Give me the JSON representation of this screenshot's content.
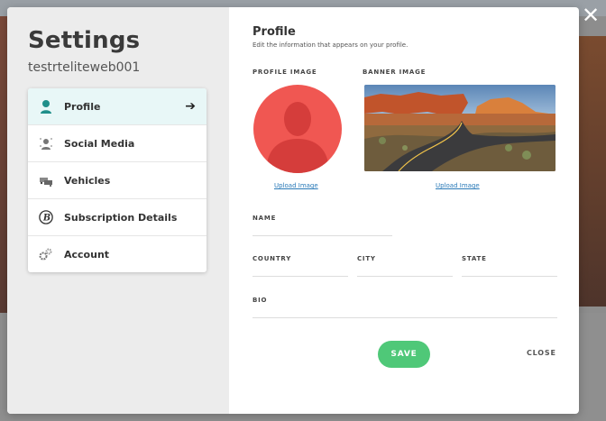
{
  "overlay": {
    "close_glyph": "✕"
  },
  "sidebar": {
    "title": "Settings",
    "username": "testrteliteweb001",
    "items": [
      {
        "label": "Profile",
        "icon": "user-icon",
        "active": true
      },
      {
        "label": "Social Media",
        "icon": "social-user-icon",
        "active": false
      },
      {
        "label": "Vehicles",
        "icon": "vehicles-icon",
        "active": false
      },
      {
        "label": "Subscription Details",
        "icon": "subscription-b-icon",
        "active": false
      },
      {
        "label": "Account",
        "icon": "gears-icon",
        "active": false
      }
    ],
    "active_arrow": "➔"
  },
  "profile": {
    "title": "Profile",
    "subtitle": "Edit the information that appears on your profile.",
    "profile_image_label": "PROFILE IMAGE",
    "banner_image_label": "BANNER IMAGE",
    "upload_profile": "Upload Image",
    "upload_banner": "Upload Image",
    "fields": {
      "name": "NAME",
      "country": "COUNTRY",
      "city": "CITY",
      "state": "STATE",
      "bio": "BIO"
    },
    "save_label": "SAVE",
    "close_label": "CLOSE"
  },
  "colors": {
    "accent_green": "#4fc878",
    "avatar_red": "#f05752",
    "active_menu_bg": "#e8f7f7",
    "link_blue": "#2a7ab8"
  }
}
